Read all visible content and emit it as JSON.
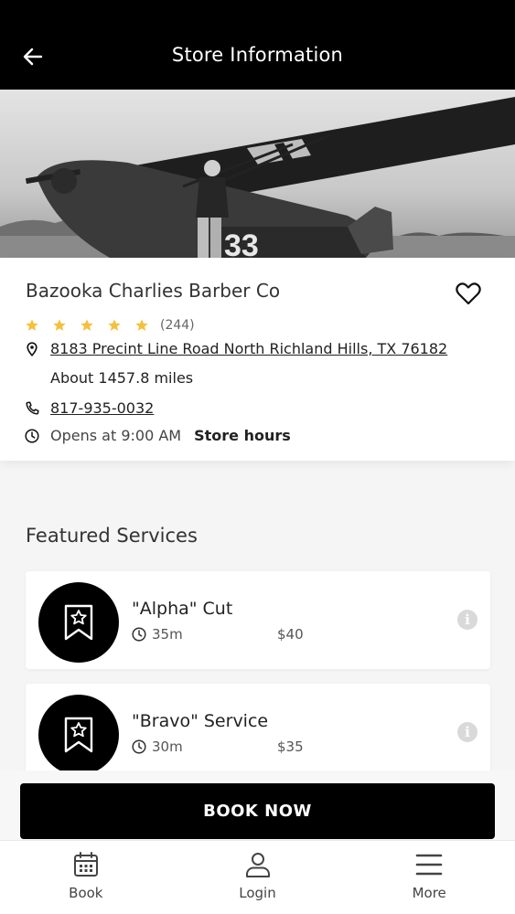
{
  "header": {
    "title": "Store Information",
    "back_icon": "arrow-left-icon"
  },
  "store": {
    "name": "Bazooka Charlies Barber Co",
    "rating": 5,
    "rating_max": 5,
    "review_count": "(244)",
    "address": "8183 Precint Line Road North Richland Hills, TX 76182",
    "distance": "About 1457.8 miles",
    "phone": "817-935-0032",
    "opens": "Opens at 9:00 AM",
    "hours_link": "Store hours",
    "star_color": "#f5c03c"
  },
  "featured": {
    "title": "Featured Services",
    "services": [
      {
        "name": "\"Alpha\" Cut",
        "duration": "35m",
        "price": "$40"
      },
      {
        "name": "\"Bravo\" Service",
        "duration": "30m",
        "price": "$35"
      }
    ]
  },
  "book_now": {
    "label": "BOOK NOW"
  },
  "tabs": [
    {
      "label": "Book",
      "icon": "calendar-icon"
    },
    {
      "label": "Login",
      "icon": "user-icon"
    },
    {
      "label": "More",
      "icon": "menu-icon"
    }
  ]
}
